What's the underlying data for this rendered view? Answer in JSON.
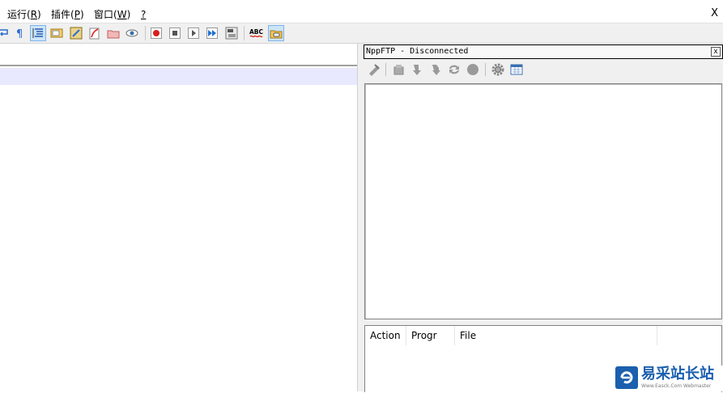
{
  "menubar": {
    "items": [
      {
        "label": "运行(",
        "mnemonic": "R",
        "suffix": ")"
      },
      {
        "label": "插件(",
        "mnemonic": "P",
        "suffix": ")"
      },
      {
        "label": "窗口(",
        "mnemonic": "W",
        "suffix": ")"
      },
      {
        "label": "",
        "mnemonic": "?",
        "suffix": ""
      }
    ],
    "close_label": "X"
  },
  "toolbar": {
    "icons": [
      "wrap-icon",
      "show-all-chars-icon",
      "indent-guide-icon",
      "doc-map-icon",
      "function-list-icon",
      "folder-workspace-icon",
      "folder-icon",
      "monitor-eye-icon",
      "record-macro-icon",
      "stop-record-icon",
      "play-macro-icon",
      "run-macro-multiple-icon",
      "save-macro-icon",
      "spell-check-icon",
      "ftp-panel-icon"
    ],
    "spell_label": "ABC"
  },
  "ftp_panel": {
    "title": "NppFTP - Disconnected",
    "close_label": "x",
    "icons": [
      "connect-icon",
      "download-icon",
      "upload-down-icon",
      "upload-icon",
      "refresh-icon",
      "abort-icon",
      "settings-gear-icon",
      "message-window-icon"
    ],
    "queue_columns": [
      {
        "label": "Action"
      },
      {
        "label": "Progr"
      },
      {
        "label": "File"
      },
      {
        "label": ""
      }
    ]
  },
  "watermark": {
    "main": "易采站长站",
    "sub": "Www.Easck.Com Webmaster",
    "accent": "#1b5fae"
  }
}
